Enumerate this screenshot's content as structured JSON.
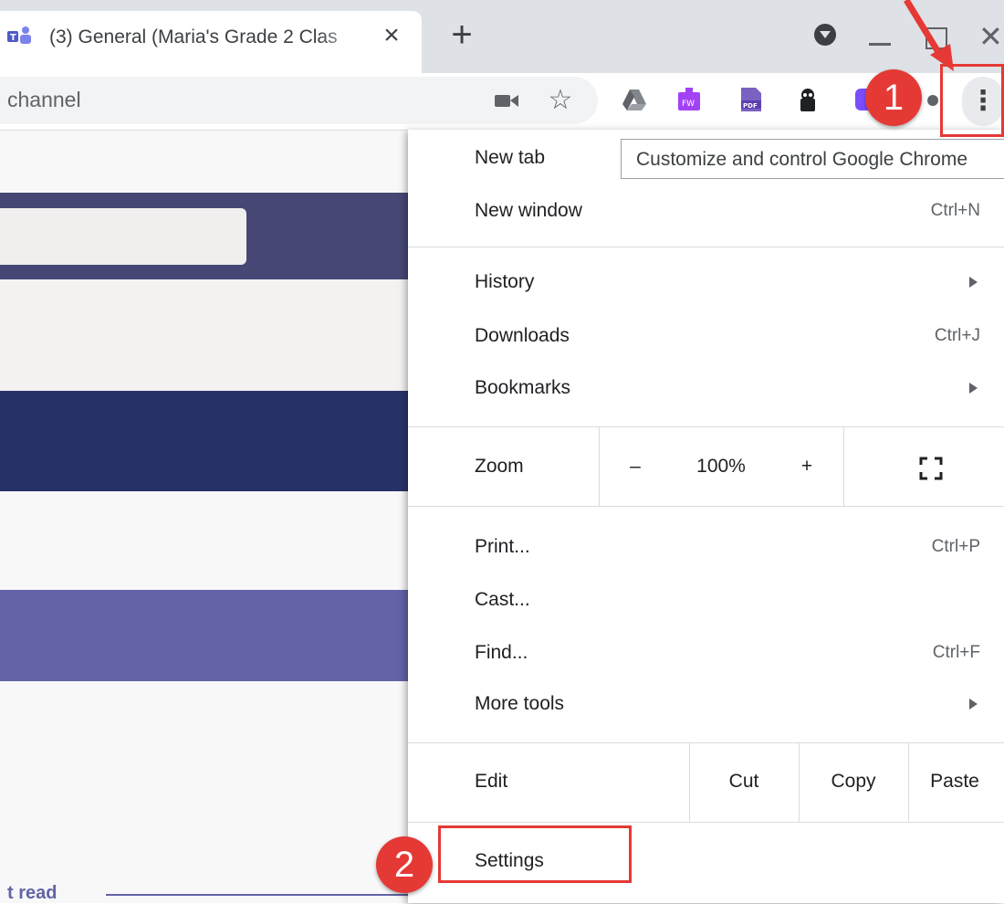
{
  "tab": {
    "title": "(3) General (Maria's Grade 2 Clas",
    "close": "×",
    "new_tab": "+"
  },
  "window": {
    "close": "✕"
  },
  "omnibox": {
    "text": "channel",
    "star": "☆"
  },
  "menu_button": {
    "label": "⋮"
  },
  "tooltip": "Customize and control Google Chrome",
  "menu": {
    "new_tab": "New tab",
    "new_window": "New window",
    "new_window_shortcut": "Ctrl+N",
    "history": "History",
    "downloads": "Downloads",
    "downloads_shortcut": "Ctrl+J",
    "bookmarks": "Bookmarks",
    "zoom": {
      "label": "Zoom",
      "minus": "–",
      "value": "100%",
      "plus": "+"
    },
    "print": "Print...",
    "print_shortcut": "Ctrl+P",
    "cast": "Cast...",
    "find": "Find...",
    "find_shortcut": "Ctrl+F",
    "more_tools": "More tools",
    "edit": {
      "label": "Edit",
      "cut": "Cut",
      "copy": "Copy",
      "paste": "Paste"
    },
    "settings": "Settings"
  },
  "page": {
    "last_read": "t read"
  },
  "annotations": {
    "step1": "1",
    "step2": "2",
    "color": "#e53935"
  },
  "colors": {
    "teams_header": "#464775",
    "teams_navy": "#283269",
    "teams_purple": "#6264a7",
    "page_light": "#f5f5f5"
  }
}
